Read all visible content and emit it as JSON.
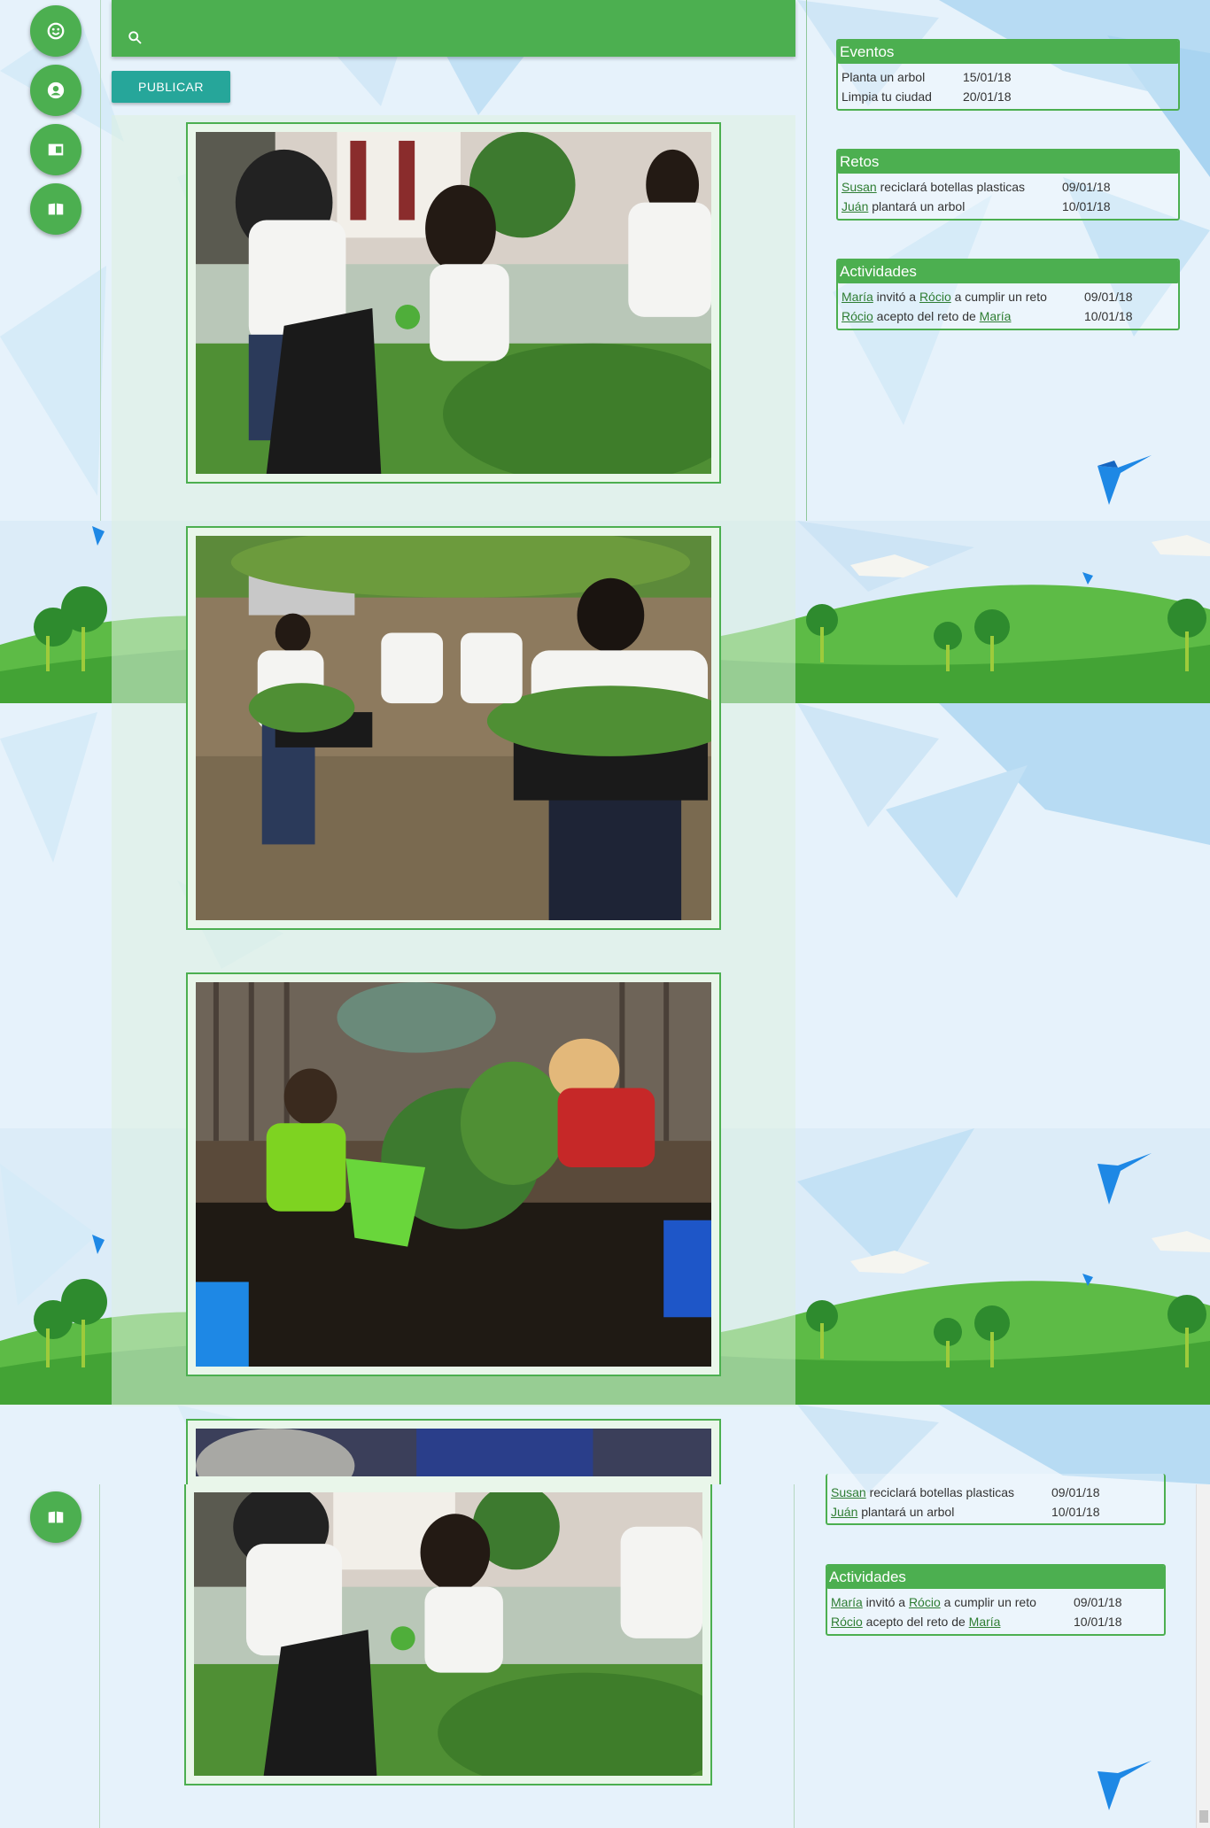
{
  "search": {
    "placeholder": ""
  },
  "nav": {
    "items": [
      {
        "name": "home",
        "icon": "smiley-icon"
      },
      {
        "name": "profile",
        "icon": "user-icon"
      },
      {
        "name": "news",
        "icon": "newspaper-icon"
      },
      {
        "name": "guide",
        "icon": "book-icon"
      }
    ]
  },
  "publish_label": "PUBLICAR",
  "widgets": {
    "eventos": {
      "title": "Eventos",
      "rows": [
        {
          "text": "Planta un arbol",
          "date": "15/01/18"
        },
        {
          "text": "Limpia tu ciudad",
          "date": "20/01/18"
        }
      ]
    },
    "retos": {
      "title": "Retos",
      "rows": [
        {
          "user": "Susan",
          "text": " reciclará botellas plasticas",
          "date": "09/01/18"
        },
        {
          "user": "Juán",
          "text": " plantará un arbol",
          "date": "10/01/18"
        }
      ]
    },
    "actividades": {
      "title": "Actividades",
      "rows": [
        {
          "user": "María",
          "mid": " invitó a ",
          "user2": "Rócio",
          "text": " a cumplir un reto",
          "date": "09/01/18"
        },
        {
          "user": "Rócio",
          "mid": " acepto del reto de ",
          "user2": "María",
          "text": "",
          "date": "10/01/18"
        }
      ]
    }
  },
  "colors": {
    "primary": "#4caf50",
    "accent": "#26a69a",
    "sky": "#e8f3fb",
    "grass": "#4cae3c"
  }
}
